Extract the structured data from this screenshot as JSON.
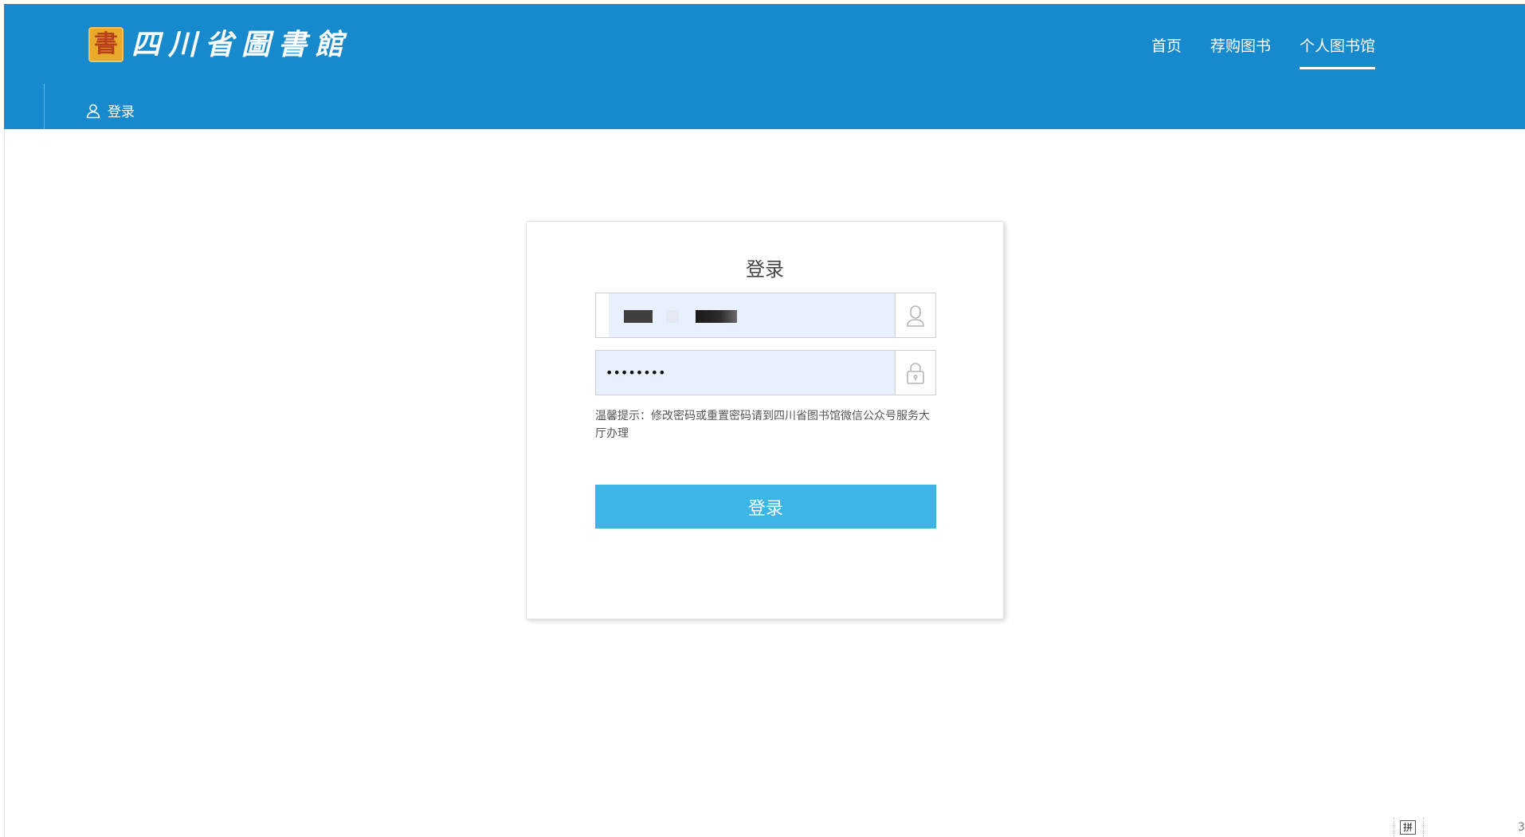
{
  "header": {
    "logo_seal": "書",
    "logo_text": "四川省圖書館",
    "nav": [
      {
        "label": "首页",
        "active": false
      },
      {
        "label": "荐购图书",
        "active": false
      },
      {
        "label": "个人图书馆",
        "active": true
      }
    ],
    "sub_login_label": "登录",
    "background_color": "#168acd"
  },
  "login_card": {
    "title": "登录",
    "username": {
      "value": "",
      "icon": "user-icon"
    },
    "password": {
      "value": "••••••••",
      "icon": "lock-icon"
    },
    "hint": "温馨提示：修改密码或重置密码请到四川省图书馆微信公众号服务大厅办理",
    "submit_label": "登录",
    "button_color": "#3db5e6"
  },
  "ime_indicator": "拼",
  "corner_text": "3"
}
